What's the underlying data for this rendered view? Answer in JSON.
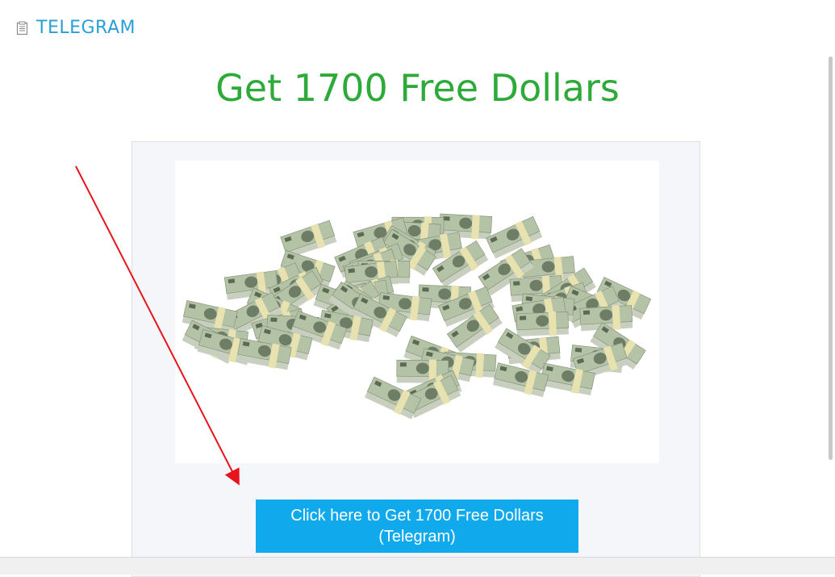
{
  "brand": {
    "icon": "document-icon",
    "label": "TELEGRAM",
    "color": "#2a9fd6"
  },
  "headline": {
    "text": "Get 1700 Free Dollars",
    "color": "#2eaa3a"
  },
  "image": {
    "alt": "pile of money"
  },
  "cta": {
    "label": "Click here to Get 1700 Free Dollars\n(Telegram)",
    "color": "#0fa9ec"
  },
  "annotation": {
    "icon": "red-arrow-icon",
    "color": "#e8141b"
  }
}
